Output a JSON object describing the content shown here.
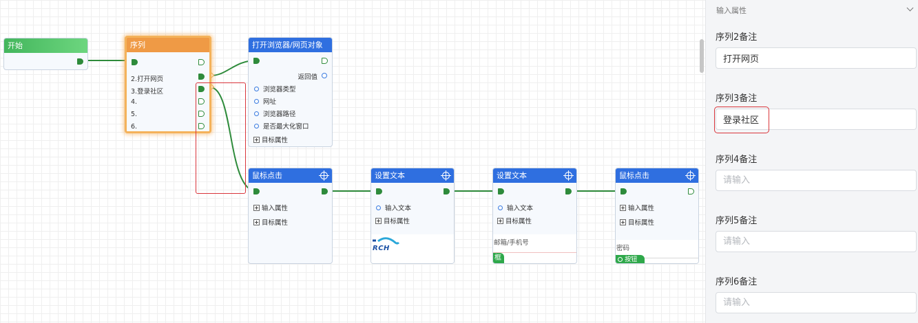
{
  "canvas": {
    "nodes": {
      "start": {
        "title": "开始"
      },
      "sequence": {
        "title": "序列",
        "rows": [
          "2.打开网页",
          "3.登录社区",
          "4.",
          "5.",
          "6."
        ]
      },
      "open_browser": {
        "title": "打开浏览器/网页对象",
        "return_label": "返回值",
        "params": [
          "浏览器类型",
          "网址",
          "浏览器路径",
          "是否最大化窗口"
        ],
        "target_props": "目标属性"
      },
      "mouse_click_1": {
        "title": "鼠标点击",
        "rows": [
          "输入属性",
          "目标属性"
        ]
      },
      "set_text_1": {
        "title": "设置文本",
        "param": "输入文本",
        "target_props": "目标属性",
        "preview_text": "RCH"
      },
      "set_text_2": {
        "title": "设置文本",
        "param": "输入文本",
        "target_props": "目标属性",
        "preview_label": "邮箱/手机号",
        "preview_tab": "框"
      },
      "mouse_click_2": {
        "title": "鼠标点击",
        "rows": [
          "输入属性",
          "目标属性"
        ],
        "preview_label": "密码",
        "preview_tab": "按钮"
      }
    }
  },
  "panel": {
    "header": "输入属性",
    "fields": [
      {
        "label": "序列2备注",
        "value": "打开网页",
        "placeholder": "请输入"
      },
      {
        "label": "序列3备注",
        "value": "登录社区",
        "placeholder": "请输入"
      },
      {
        "label": "序列4备注",
        "value": "",
        "placeholder": "请输入"
      },
      {
        "label": "序列5备注",
        "value": "",
        "placeholder": "请输入"
      },
      {
        "label": "序列6备注",
        "value": "",
        "placeholder": "请输入"
      }
    ]
  },
  "colors": {
    "wire": "#2e8b3b",
    "title_green": "#43b65c",
    "title_orange": "#ef9a45",
    "title_blue": "#2f6fe0",
    "highlight": "#d9343a",
    "selection_glow": "#f4b25a"
  }
}
